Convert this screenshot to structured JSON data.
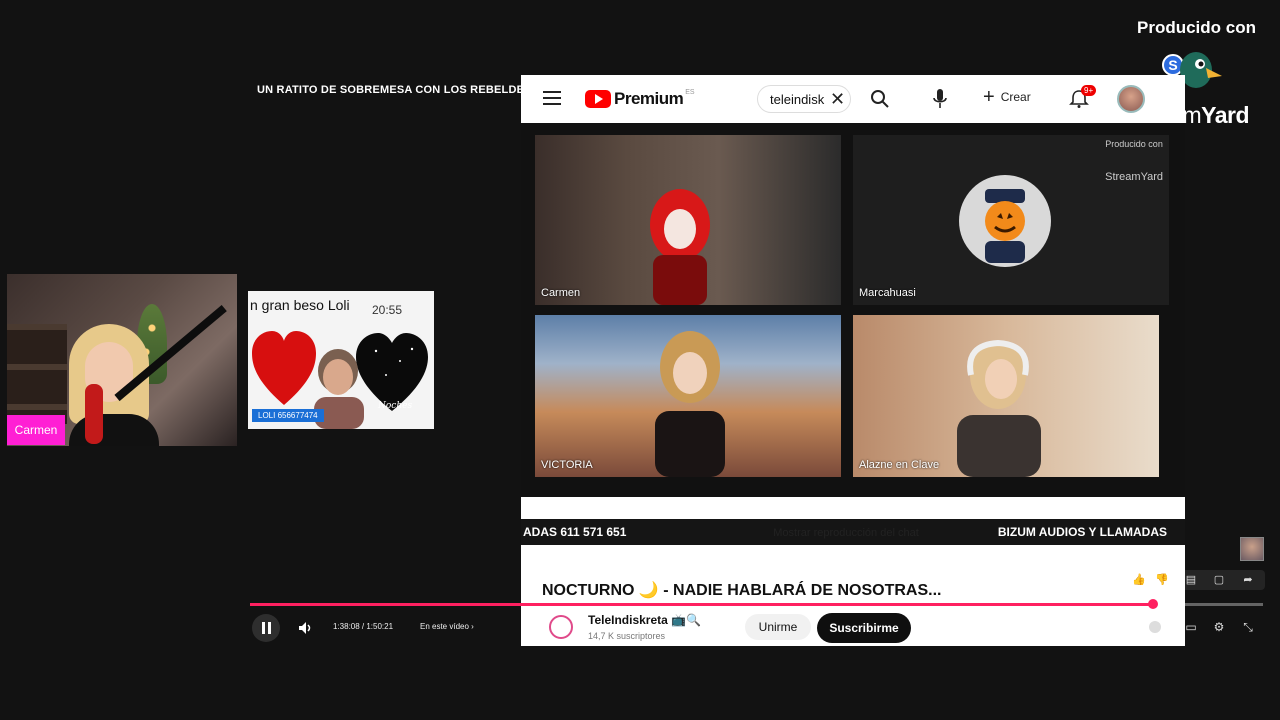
{
  "branding": {
    "producer_label": "Producido con",
    "streamyard_badge": "S",
    "streamyard_name_light": "Stream",
    "streamyard_name_bold": "Yard"
  },
  "overlay": {
    "show_title": "UN RATITO DE SOBREMESA CON LOS REBELDES"
  },
  "webcam": {
    "name_tag": "Carmen",
    "name_tag_color": "#ff1fd4"
  },
  "comment_card": {
    "message": "n gran beso Loli",
    "time": "20:55",
    "signature": "Noches",
    "badge": "LOLI 656677474",
    "badge_color": "#1a6fd6"
  },
  "youtube": {
    "brand": "Premium",
    "brand_sup": "ES",
    "search_value": "teleindisk",
    "create_label": "Crear",
    "notification_count": "9+",
    "icons": [
      "menu-icon",
      "search-icon",
      "mic-icon",
      "plus-icon",
      "bell-icon",
      "close-icon"
    ],
    "stream": {
      "tiles": [
        {
          "label": "Carmen"
        },
        {
          "label": "Marcahuasi"
        },
        {
          "label": "VICTORIA"
        },
        {
          "label": "Alazne en Clave"
        }
      ],
      "watermark_top": "Producido con",
      "watermark_bottom": "StreamYard",
      "ticker_left": "ADAS 611 571 651",
      "ticker_right": "BIZUM AUDIOS Y LLAMADAS"
    },
    "chat_replay_label": "Mostrar reproducción del chat",
    "video_title": "NOCTURNO 🌙 - NADIE HABLARÁ DE NOSOTRAS...",
    "channel": {
      "name": "TeleIndiskreta 📺🔍",
      "subscribers": "14,7 K suscriptores"
    },
    "join_label": "Unirme",
    "subscribe_label": "Suscribirme",
    "accent": "#ff0000"
  },
  "player": {
    "timecode": "1:38:08 / 1:50:21",
    "chapter_label": "En este vídeo ›",
    "progress": 0.89,
    "progress_color": "#ff2060",
    "icons": [
      "pause-icon",
      "volume-icon",
      "like-icon",
      "dislike-icon",
      "captions-icon",
      "comment-icon",
      "share-icon",
      "subtitles-icon",
      "settings-icon",
      "exit-fullscreen-icon"
    ]
  }
}
